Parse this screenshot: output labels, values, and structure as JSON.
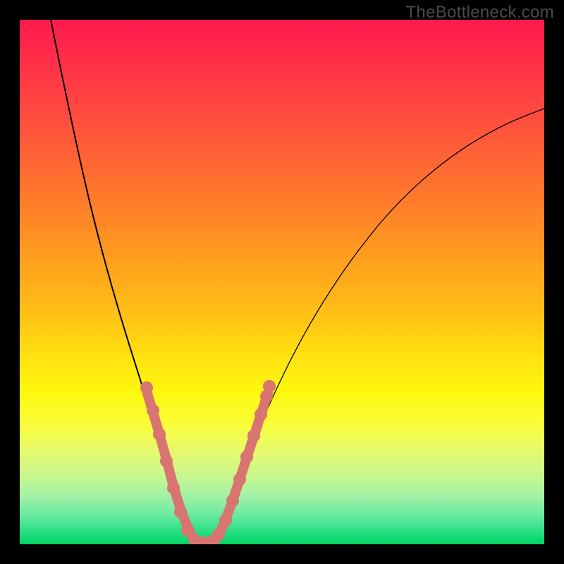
{
  "watermark": "TheBottleneck.com",
  "chart_data": {
    "type": "line",
    "title": "",
    "xlabel": "",
    "ylabel": "",
    "xlim": [
      0,
      100
    ],
    "ylim": [
      0,
      100
    ],
    "series": [
      {
        "name": "bottleneck-curve",
        "x": [
          5,
          8,
          11,
          14,
          17,
          20,
          23,
          25,
          27,
          29,
          31,
          33,
          35,
          37,
          40,
          44,
          48,
          52,
          56,
          60,
          66,
          74,
          84,
          92,
          100
        ],
        "values": [
          100,
          88,
          76,
          64,
          53,
          42,
          32,
          25,
          18,
          12,
          7,
          3,
          1,
          2,
          6,
          14,
          24,
          33,
          41,
          48,
          56,
          64,
          72,
          78,
          82
        ]
      }
    ],
    "highlighted_region": {
      "name": "optimal-range-dots",
      "x": [
        23,
        24,
        25,
        27,
        29,
        30,
        31,
        33,
        35,
        37,
        38,
        39,
        40,
        41,
        42,
        43,
        44
      ],
      "values": [
        35,
        31,
        26,
        17,
        10,
        6,
        3,
        1,
        1,
        2,
        4,
        7,
        11,
        15,
        19,
        23,
        28
      ]
    }
  }
}
